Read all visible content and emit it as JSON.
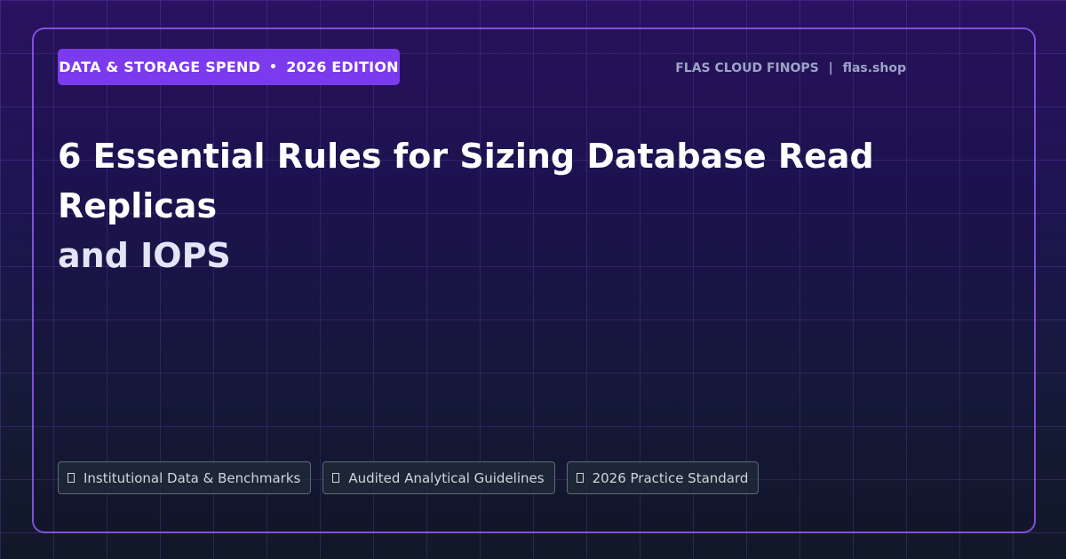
{
  "header": {
    "badge": {
      "category": "DATA & STORAGE SPEND",
      "separator": "•",
      "edition": "2026 EDITION"
    },
    "brand": {
      "name": "FLAS CLOUD FINOPS",
      "separator": "|",
      "site": "flas.shop"
    }
  },
  "title": {
    "line1": "6 Essential Rules for Sizing Database Read Replicas",
    "line2": "and IOPS"
  },
  "tags": [
    {
      "icon": "box-icon",
      "label": "Institutional Data & Benchmarks"
    },
    {
      "icon": "box-icon",
      "label": "Audited Analytical Guidelines"
    },
    {
      "icon": "box-icon",
      "label": "2026 Practice Standard"
    }
  ],
  "colors": {
    "accent": "#7c3aed",
    "border": "#935af6",
    "background_top": "#2a1260",
    "background_bottom": "#111827"
  }
}
